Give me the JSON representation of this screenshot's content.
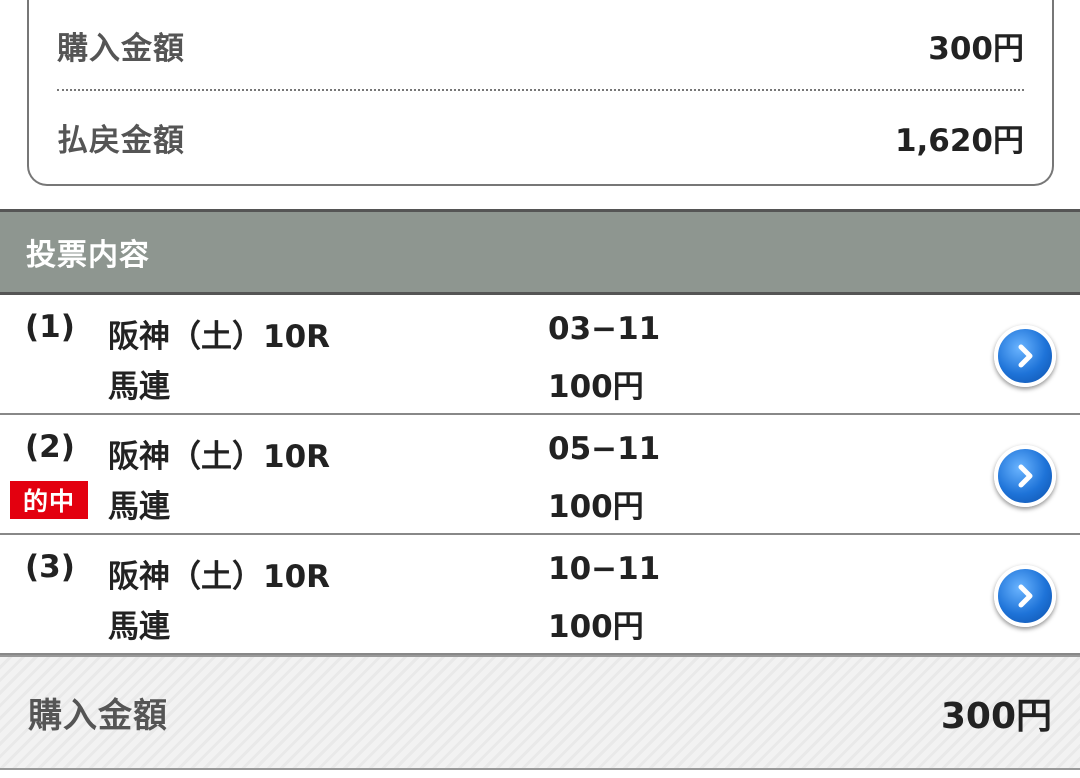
{
  "summary": {
    "purchase_label": "購入金額",
    "purchase_value": "300円",
    "payout_label": "払戻金額",
    "payout_value": "1,620円"
  },
  "section": {
    "title": "投票内容"
  },
  "bets": [
    {
      "num": "(1)",
      "race": "阪神（土）10R",
      "type": "馬連",
      "combo": "03−11",
      "amount": "100円",
      "hit": ""
    },
    {
      "num": "(2)",
      "race": "阪神（土）10R",
      "type": "馬連",
      "combo": "05−11",
      "amount": "100円",
      "hit": "的中"
    },
    {
      "num": "(3)",
      "race": "阪神（土）10R",
      "type": "馬連",
      "combo": "10−11",
      "amount": "100円",
      "hit": ""
    }
  ],
  "footer": {
    "purchase_label": "購入金額",
    "purchase_value": "300円"
  },
  "icons": {
    "row_arrow": "chevron-right-circle-icon"
  },
  "colors": {
    "header_bg": "#8e9690",
    "hit_badge": "#e3000f",
    "arrow_blue": "#1e73d8"
  }
}
